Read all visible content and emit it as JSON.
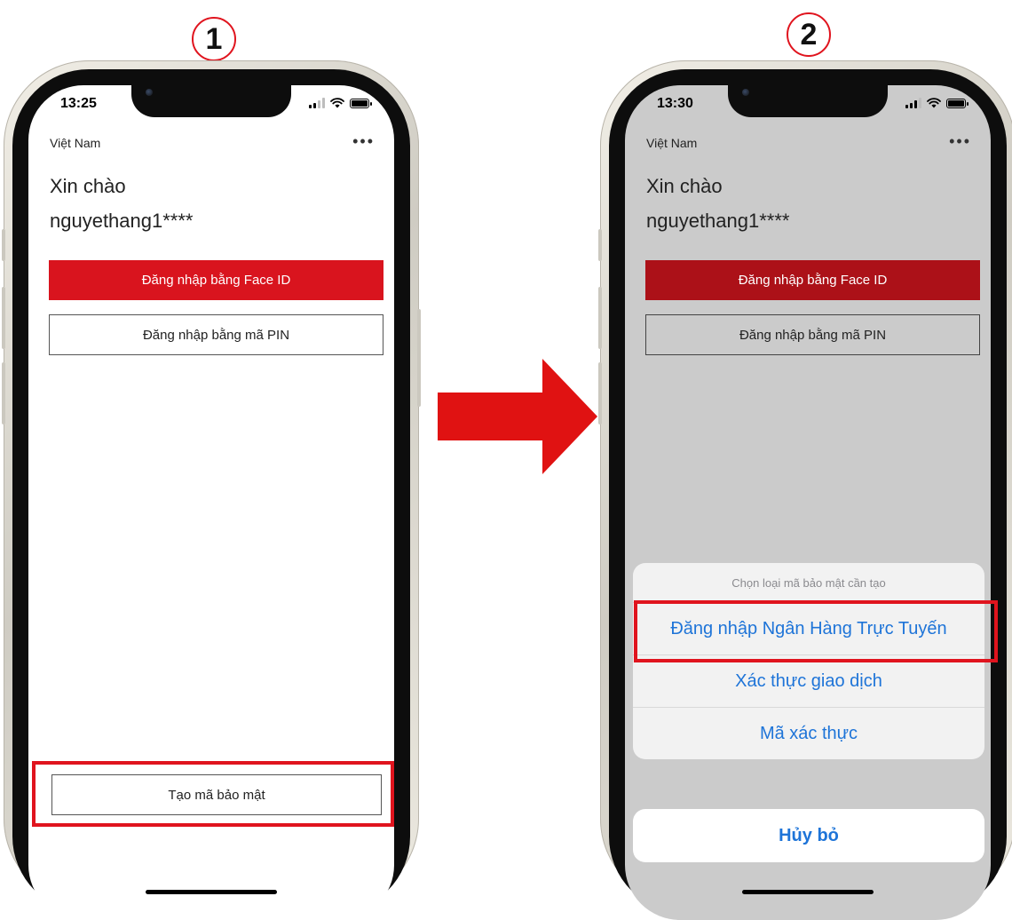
{
  "steps": [
    "1",
    "2"
  ],
  "colors": {
    "brand_red": "#d9141e",
    "highlight": "#e0141e",
    "ios_blue": "#1e74d8"
  },
  "phone1": {
    "status_time": "13:25",
    "country": "Việt Nam",
    "greeting": "Xin chào",
    "username": "nguyethang1****",
    "faceid_button": "Đăng nhập bằng Face ID",
    "pin_button": "Đăng nhập bằng mã PIN",
    "create_button": "Tạo mã bảo mật"
  },
  "phone2": {
    "status_time": "13:30",
    "country": "Việt Nam",
    "greeting": "Xin chào",
    "username": "nguyethang1****",
    "faceid_button": "Đăng nhập bằng Face ID",
    "pin_button": "Đăng nhập bằng mã PIN",
    "sheet": {
      "title": "Chọn loại mã bảo mật cần tạo",
      "options": [
        "Đăng nhập Ngân Hàng Trực Tuyến",
        "Xác thực giao dịch",
        "Mã xác thực"
      ],
      "cancel": "Hủy bỏ"
    }
  },
  "icons": [
    "more-icon",
    "signal-icon",
    "wifi-icon",
    "battery-icon",
    "right-arrow-icon"
  ]
}
